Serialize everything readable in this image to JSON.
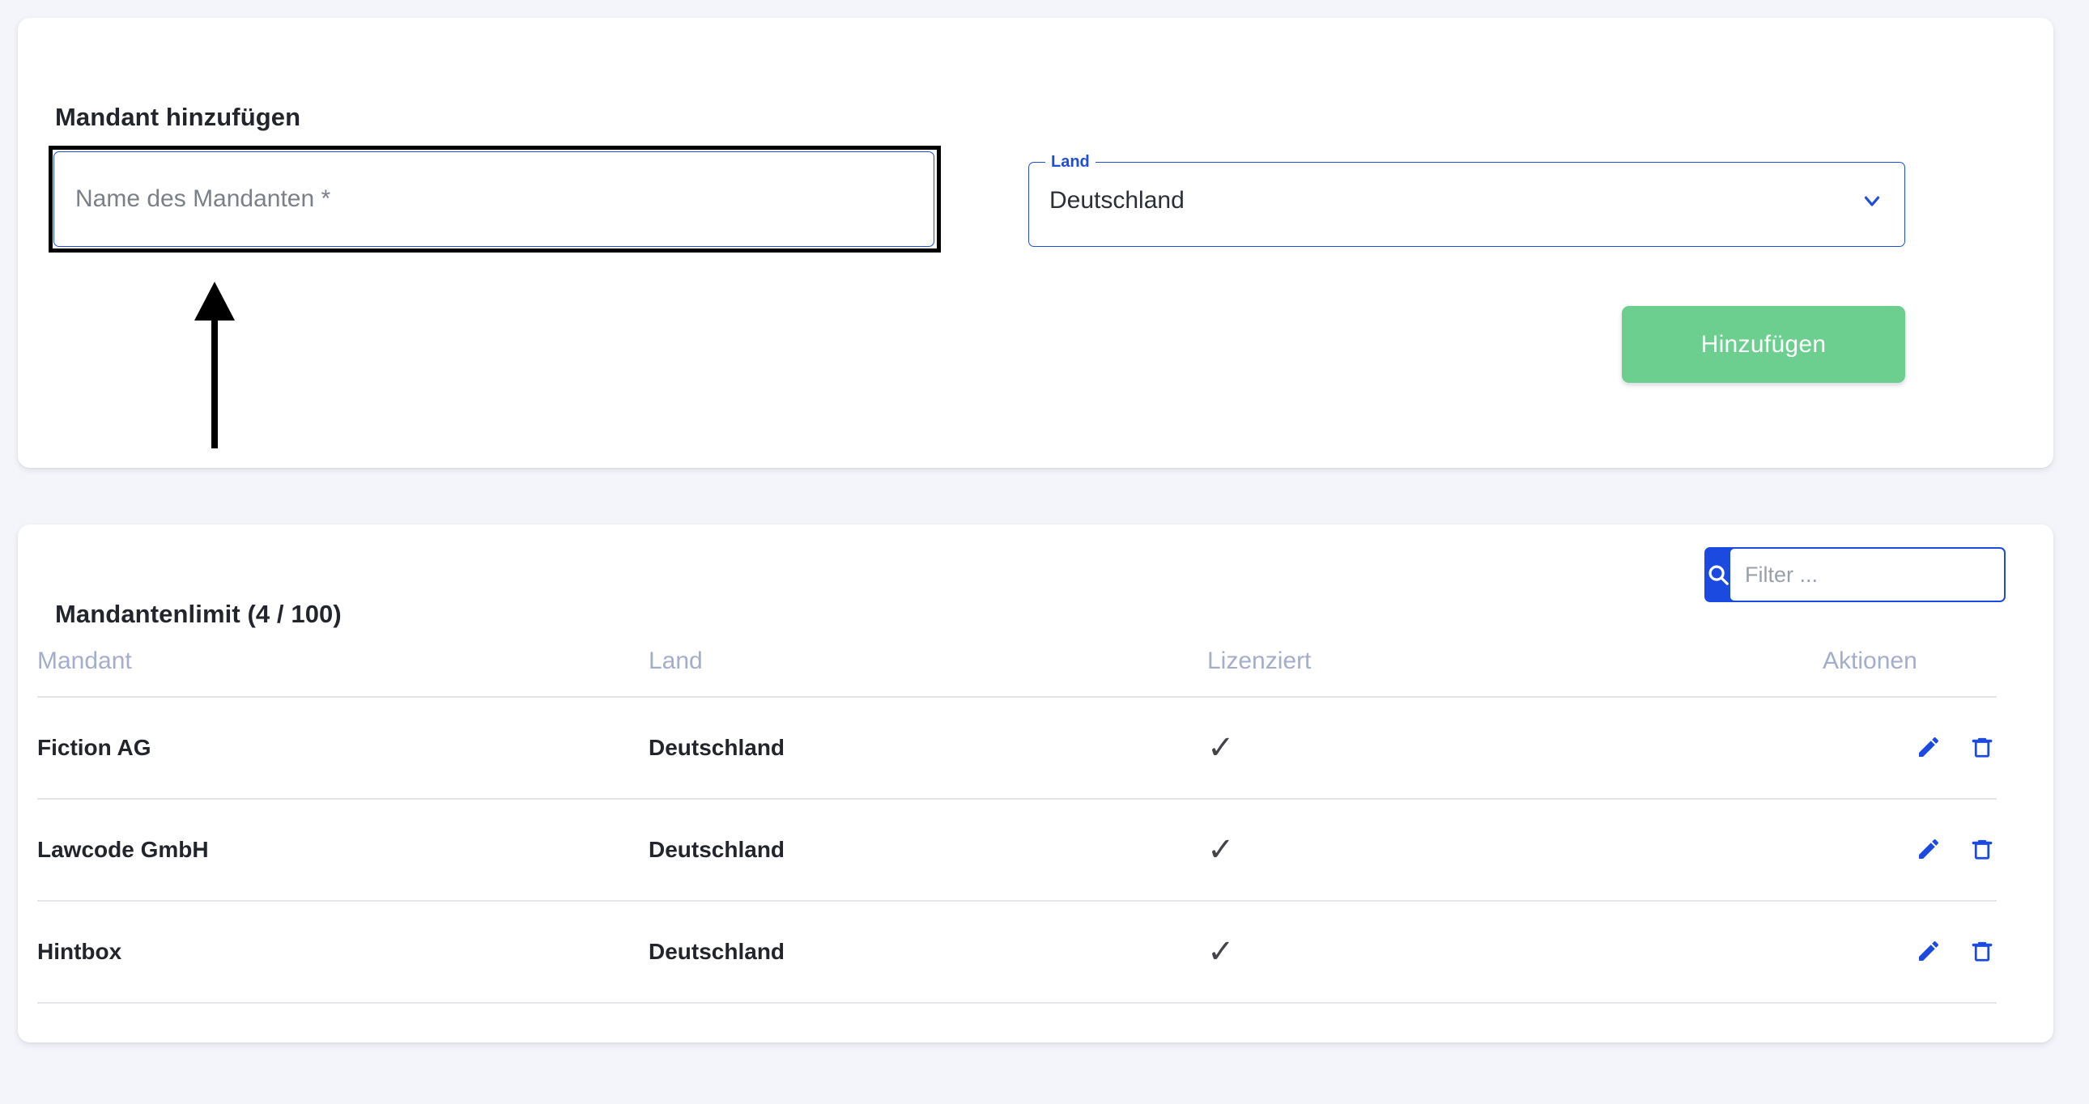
{
  "add_card": {
    "title": "Mandant hinzufügen",
    "name_input": {
      "value": "",
      "placeholder": "Name des Mandanten *"
    },
    "country_select": {
      "label": "Land",
      "value": "Deutschland",
      "caret_icon": "chevron-down-icon"
    },
    "submit_label": "Hinzufügen",
    "annotation": {
      "highlight_target": "name-input",
      "arrow_icon": "up-arrow-annotation"
    }
  },
  "list_card": {
    "title": "Mandantenlimit (4 / 100)",
    "filter": {
      "placeholder": "Filter ...",
      "value": "",
      "search_icon": "search-icon"
    },
    "table": {
      "columns": [
        "Mandant",
        "Land",
        "Lizenziert",
        "Aktionen"
      ],
      "rows": [
        {
          "mandant": "Fiction AG",
          "land": "Deutschland",
          "lizenziert": "✓",
          "actions": [
            "edit-icon",
            "delete-icon"
          ]
        },
        {
          "mandant": "Lawcode GmbH",
          "land": "Deutschland",
          "lizenziert": "✓",
          "actions": [
            "edit-icon",
            "delete-icon"
          ]
        },
        {
          "mandant": "Hintbox",
          "land": "Deutschland",
          "lizenziert": "✓",
          "actions": [
            "edit-icon",
            "delete-icon"
          ]
        }
      ]
    }
  },
  "colors": {
    "page_background": "#f4f5fa",
    "card_background": "#ffffff",
    "primary_blue": "#1d4ed8",
    "search_blue": "#1b4ae0",
    "submit_green": "#6ccf8f",
    "header_gray_blue": "#a4adca",
    "text_dark": "#22252b",
    "placeholder_gray": "#7b7f87",
    "divider": "#e3e5ea",
    "annotation_black": "#000000"
  }
}
